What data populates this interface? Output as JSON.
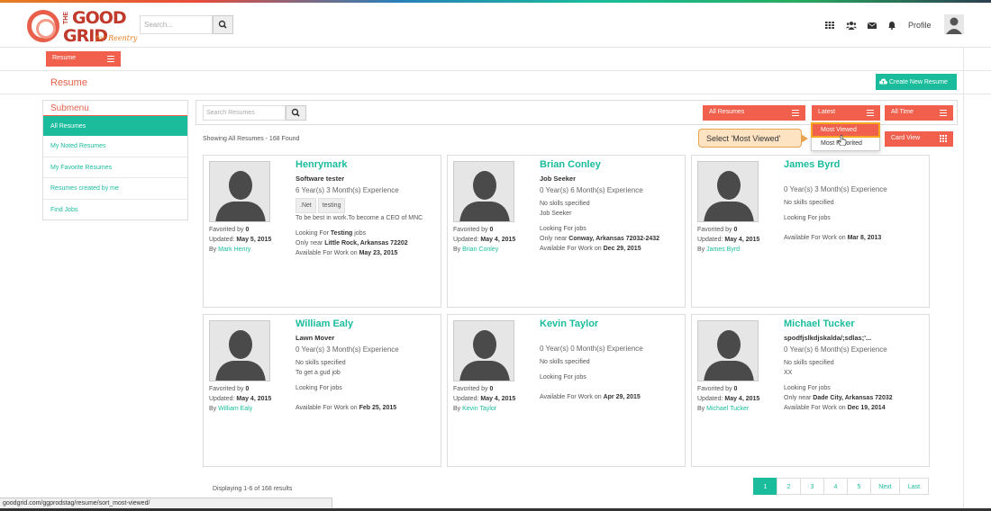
{
  "header": {
    "logo_the": "THE",
    "logo_good": "GOOD",
    "logo_grid": "GRID",
    "logo_sub": "for Reentry",
    "search_placeholder": "Search...",
    "profile_label": "Profile",
    "icons": [
      "apps-grid-icon",
      "users-icon",
      "envelope-icon",
      "bell-icon"
    ]
  },
  "subbar": {
    "resume_menu": "Resume"
  },
  "page": {
    "title": "Resume",
    "create_button": "Create New Resume"
  },
  "sidebar": {
    "heading": "Submenu",
    "items": [
      {
        "label": "All Resumes",
        "active": true
      },
      {
        "label": "My Noted Resumes"
      },
      {
        "label": "My Favorite Resumes"
      },
      {
        "label": "Resumes created by me"
      },
      {
        "label": "Find Jobs"
      }
    ]
  },
  "filters": {
    "search_placeholder": "Search Resumes",
    "found_text": "Showing All Resumes - 168 Found",
    "scope": "All Resumes",
    "sort": "Latest",
    "period": "All Time",
    "view": "Card View",
    "sort_options": [
      "Most Viewed",
      "Most Favorited"
    ],
    "sort_option_visible": [
      "Most Viewed",
      "Most F",
      "orited"
    ]
  },
  "callout": {
    "text": "Select 'Most Viewed'"
  },
  "cards": [
    {
      "name": "Henrymark",
      "title": "Software tester",
      "experience": "6 Year(s) 3 Month(s) Experience",
      "tags": [
        ".Net",
        "testing"
      ],
      "objective": "To be best in work.To become a CEO of MNC",
      "looking_prefix": "Looking For ",
      "looking_bold": "Testing",
      "looking_suffix": " jobs",
      "only_near_prefix": "Only near ",
      "only_near": "Little Rock, Arkansas 72202",
      "available_prefix": "Available For Work on ",
      "available": "May 23, 2015",
      "favorited_prefix": "Favorited by ",
      "favorited": "0",
      "updated_prefix": "Updated: ",
      "updated": "May 5, 2015",
      "by_prefix": "By ",
      "by": "Mark Henry"
    },
    {
      "name": "Brian Conley",
      "title": "Job Seeker",
      "experience": "0 Year(s) 6 Month(s) Experience",
      "skills": "No skills specified",
      "objective": "Job Seeker",
      "looking": "Looking For jobs",
      "only_near_prefix": "Only near ",
      "only_near": "Conway, Arkansas 72032-2432",
      "available_prefix": "Available For Work on ",
      "available": "Dec 29, 2015",
      "favorited_prefix": "Favorited by ",
      "favorited": "0",
      "updated_prefix": "Updated: ",
      "updated": "May 4, 2015",
      "by_prefix": "By ",
      "by": "Brian Conley"
    },
    {
      "name": "James Byrd",
      "experience": "0 Year(s) 3 Month(s) Experience",
      "skills": "No skills specified",
      "looking": "Looking For jobs",
      "available_prefix": "Available For Work on ",
      "available": "Mar 8, 2013",
      "favorited_prefix": "Favorited by ",
      "favorited": "0",
      "updated_prefix": "Updated: ",
      "updated": "May 4, 2015",
      "by_prefix": "By ",
      "by": "James Byrd"
    },
    {
      "name": "William Ealy",
      "title": "Lawn Mover",
      "experience": "0 Year(s) 3 Month(s) Experience",
      "skills": "No skills specified",
      "objective": "To get a gud job",
      "looking": "Looking For jobs",
      "available_prefix": "Available For Work on ",
      "available": "Feb 25, 2015",
      "favorited_prefix": "Favorited by ",
      "favorited": "0",
      "updated_prefix": "Updated: ",
      "updated": "May 4, 2015",
      "by_prefix": "By ",
      "by": "William Ealy"
    },
    {
      "name": "Kevin Taylor",
      "experience": "0 Year(s) 0 Month(s) Experience",
      "skills": "No skills specified",
      "looking": "Looking For jobs",
      "available_prefix": "Available For Work on ",
      "available": "Apr 29, 2015",
      "favorited_prefix": "Favorited by ",
      "favorited": "0",
      "updated_prefix": "Updated: ",
      "updated": "May 4, 2015",
      "by_prefix": "By ",
      "by": "Kevin Taylor"
    },
    {
      "name": "Michael Tucker",
      "title": "spodfjslkdjskalda/;sdlas;'...",
      "experience": "0 Year(s) 6 Month(s) Experience",
      "skills": "No skills specified",
      "objective": "XX",
      "looking": "Looking For jobs",
      "only_near_prefix": "Only near ",
      "only_near": "Dade City, Arkansas 72032",
      "available_prefix": "Available For Work on ",
      "available": "Dec 19, 2014",
      "favorited_prefix": "Favorited by ",
      "favorited": "0",
      "updated_prefix": "Updated: ",
      "updated": "May 4, 2015",
      "by_prefix": "By ",
      "by": "Michael Tucker"
    }
  ],
  "pagination": {
    "displaying": "Displaying 1-6 of 168 results",
    "pages": [
      "1",
      "2",
      "3",
      "4",
      "5",
      "Next",
      "Last"
    ],
    "active": "1"
  },
  "status_url": "goodgrid.com/ggprodstag/resume/sort_most-viewed/",
  "colors": {
    "accent_red": "#f0604d",
    "accent_teal": "#1abc9c",
    "callout_bg": "#fde3c2"
  }
}
